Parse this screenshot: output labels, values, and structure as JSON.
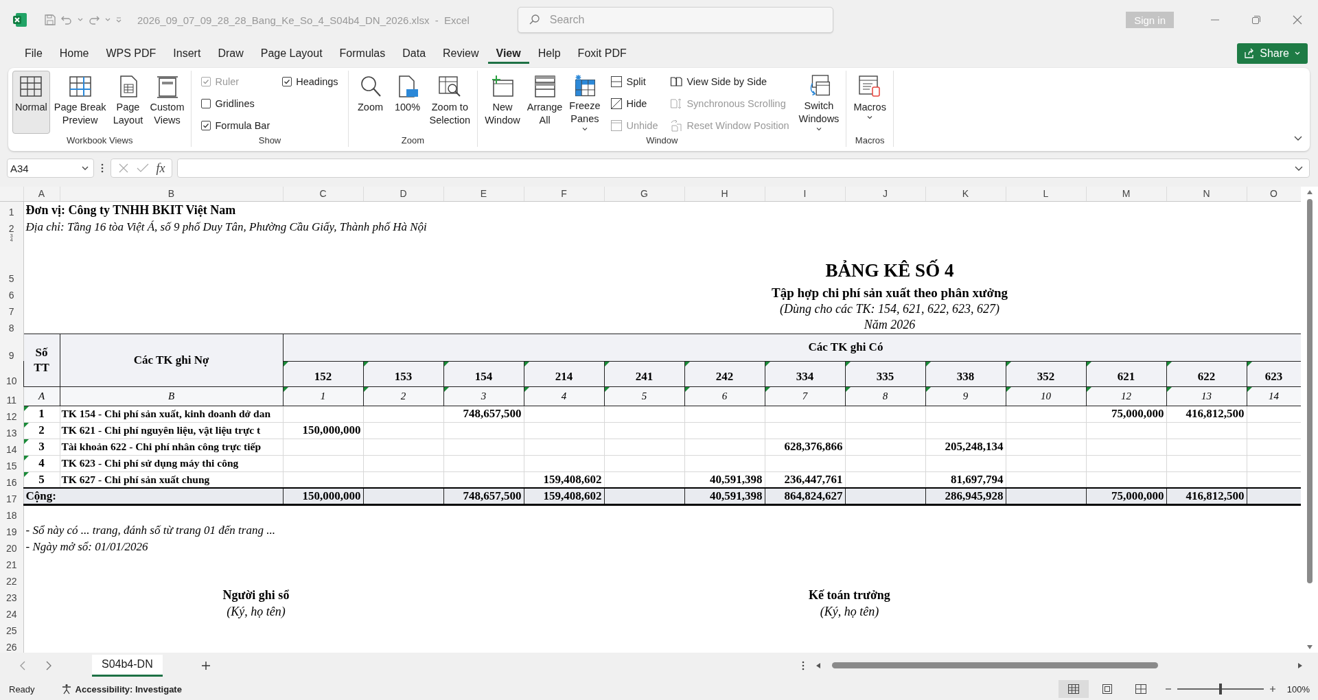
{
  "window": {
    "title": "2026_09_07_09_28_28_Bang_Ke_So_4_S04b4_DN_2026.xlsx  -  Excel"
  },
  "search": {
    "placeholder": "Search"
  },
  "account": {
    "sign_in": "Sign in"
  },
  "menu_tabs": [
    {
      "label": "File",
      "selected": false
    },
    {
      "label": "Home",
      "selected": false
    },
    {
      "label": "WPS PDF",
      "selected": false
    },
    {
      "label": "Insert",
      "selected": false
    },
    {
      "label": "Draw",
      "selected": false
    },
    {
      "label": "Page Layout",
      "selected": false
    },
    {
      "label": "Formulas",
      "selected": false
    },
    {
      "label": "Data",
      "selected": false
    },
    {
      "label": "Review",
      "selected": false
    },
    {
      "label": "View",
      "selected": true
    },
    {
      "label": "Help",
      "selected": false
    },
    {
      "label": "Foxit PDF",
      "selected": false
    }
  ],
  "share_button": "Share",
  "ribbon": {
    "groups": [
      {
        "label": "Workbook Views",
        "items": [
          {
            "kind": "large",
            "label": "Normal",
            "selected": true,
            "dropdown": false
          },
          {
            "kind": "large",
            "label": "Page Break\nPreview",
            "selected": false,
            "dropdown": false
          },
          {
            "kind": "large",
            "label": "Page\nLayout",
            "selected": false,
            "dropdown": false
          },
          {
            "kind": "large",
            "label": "Custom\nViews",
            "selected": false,
            "dropdown": false
          }
        ]
      },
      {
        "label": "Show",
        "items": [
          {
            "kind": "check",
            "label": "Ruler",
            "checked": true,
            "disabled": true
          },
          {
            "kind": "check",
            "label": "Gridlines",
            "checked": false,
            "disabled": false
          },
          {
            "kind": "check",
            "label": "Formula Bar",
            "checked": true,
            "disabled": false
          },
          {
            "kind": "check",
            "label": "Headings",
            "checked": true,
            "disabled": false
          }
        ]
      },
      {
        "label": "Zoom",
        "items": [
          {
            "kind": "large",
            "label": "Zoom",
            "selected": false,
            "dropdown": false
          },
          {
            "kind": "large",
            "label": "100%",
            "selected": false,
            "dropdown": false
          },
          {
            "kind": "large",
            "label": "Zoom to\nSelection",
            "selected": false,
            "dropdown": false
          }
        ]
      },
      {
        "label": "Window",
        "items": [
          {
            "kind": "large",
            "label": "New\nWindow",
            "selected": false,
            "dropdown": false
          },
          {
            "kind": "large",
            "label": "Arrange\nAll",
            "selected": false,
            "dropdown": false
          },
          {
            "kind": "large",
            "label": "Freeze\nPanes",
            "selected": false,
            "dropdown": true
          },
          {
            "kind": "small",
            "label": "Split",
            "disabled": false
          },
          {
            "kind": "small",
            "label": "Hide",
            "disabled": false
          },
          {
            "kind": "small",
            "label": "Unhide",
            "disabled": true
          },
          {
            "kind": "small",
            "label": "View Side by Side",
            "disabled": false
          },
          {
            "kind": "small",
            "label": "Synchronous Scrolling",
            "disabled": true
          },
          {
            "kind": "small",
            "label": "Reset Window Position",
            "disabled": true
          },
          {
            "kind": "large",
            "label": "Switch\nWindows",
            "selected": false,
            "dropdown": true
          }
        ]
      },
      {
        "label": "Macros",
        "items": [
          {
            "kind": "large",
            "label": "Macros",
            "selected": false,
            "dropdown": true
          }
        ]
      }
    ]
  },
  "formula_bar": {
    "name_box": "A34",
    "function_button": "fx"
  },
  "columns": [
    "A",
    "B",
    "C",
    "D",
    "E",
    "F",
    "G",
    "H",
    "I",
    "J",
    "K",
    "L",
    "M",
    "N",
    "O"
  ],
  "row_numbers": [
    "1",
    "2",
    "3",
    "4",
    "5",
    "6",
    "7",
    "8",
    "9",
    "10",
    "11",
    "12",
    "13",
    "14",
    "15",
    "16",
    "17",
    "18",
    "19",
    "20",
    "21",
    "22",
    "23",
    "24",
    "25",
    "26"
  ],
  "sheet": {
    "unit": "Đơn vị: Công ty TNHH BKIT Việt Nam",
    "address": "Địa chỉ: Tầng 16 tòa Việt Á, số 9 phố Duy Tân, Phường Cầu Giấy, Thành phố Hà Nội",
    "title": "BẢNG KÊ SỐ 4",
    "subtitle": "Tập hợp chi phí sản xuất theo phân xưởng",
    "scope": "(Dùng cho các TK: 154, 621, 622, 623, 627)",
    "year": "Năm 2026",
    "table": {
      "no_header": "Số TT",
      "debit_header": "Các TK ghi Nợ",
      "credit_header": "Các TK ghi Có",
      "index_a": "A",
      "index_b": "B",
      "credit_accounts": [
        {
          "account": "152",
          "index": "1",
          "flagged": true
        },
        {
          "account": "153",
          "index": "2",
          "flagged": true
        },
        {
          "account": "154",
          "index": "3",
          "flagged": true
        },
        {
          "account": "214",
          "index": "4",
          "flagged": true
        },
        {
          "account": "241",
          "index": "5",
          "flagged": true
        },
        {
          "account": "242",
          "index": "6",
          "flagged": true
        },
        {
          "account": "334",
          "index": "7",
          "flagged": true
        },
        {
          "account": "335",
          "index": "8",
          "flagged": true
        },
        {
          "account": "338",
          "index": "9",
          "flagged": true
        },
        {
          "account": "352",
          "index": "10",
          "flagged": true
        },
        {
          "account": "621",
          "index": "12",
          "flagged": true
        },
        {
          "account": "622",
          "index": "13",
          "flagged": true
        },
        {
          "account": "623",
          "index": "14",
          "flagged": true
        }
      ],
      "rows": [
        {
          "no": "1",
          "flagged": true,
          "account": "TK 154 - Chi phí sản xuất, kinh doanh dở dan",
          "amounts": [
            {
              "kind": "blank"
            },
            {
              "kind": "blank"
            },
            {
              "kind": "amount",
              "value": "748,657,500"
            },
            {
              "kind": "blank"
            },
            {
              "kind": "blank"
            },
            {
              "kind": "blank"
            },
            {
              "kind": "blank"
            },
            {
              "kind": "blank"
            },
            {
              "kind": "blank"
            },
            {
              "kind": "blank"
            },
            {
              "kind": "amount",
              "value": "75,000,000"
            },
            {
              "kind": "amount",
              "value": "416,812,500"
            },
            {
              "kind": "blank"
            }
          ]
        },
        {
          "no": "2",
          "flagged": true,
          "account": "TK 621 - Chi phí nguyên liệu, vật liệu trực t",
          "amounts": [
            {
              "kind": "amount",
              "value": "150,000,000"
            },
            {
              "kind": "blank"
            },
            {
              "kind": "blank"
            },
            {
              "kind": "blank"
            },
            {
              "kind": "blank"
            },
            {
              "kind": "blank"
            },
            {
              "kind": "blank"
            },
            {
              "kind": "blank"
            },
            {
              "kind": "blank"
            },
            {
              "kind": "blank"
            },
            {
              "kind": "blank"
            },
            {
              "kind": "blank"
            },
            {
              "kind": "blank"
            }
          ]
        },
        {
          "no": "3",
          "flagged": true,
          "account": "Tài khoản 622 - Chi phí nhân công trực tiếp",
          "amounts": [
            {
              "kind": "blank"
            },
            {
              "kind": "blank"
            },
            {
              "kind": "blank"
            },
            {
              "kind": "blank"
            },
            {
              "kind": "blank"
            },
            {
              "kind": "blank"
            },
            {
              "kind": "amount",
              "value": "628,376,866"
            },
            {
              "kind": "blank"
            },
            {
              "kind": "amount",
              "value": "205,248,134"
            },
            {
              "kind": "blank"
            },
            {
              "kind": "blank"
            },
            {
              "kind": "blank"
            },
            {
              "kind": "blank"
            }
          ]
        },
        {
          "no": "4",
          "flagged": true,
          "account": "TK 623 - Chi phí sử dụng máy thi công",
          "amounts": [
            {
              "kind": "blank"
            },
            {
              "kind": "blank"
            },
            {
              "kind": "blank"
            },
            {
              "kind": "blank"
            },
            {
              "kind": "blank"
            },
            {
              "kind": "blank"
            },
            {
              "kind": "blank"
            },
            {
              "kind": "blank"
            },
            {
              "kind": "blank"
            },
            {
              "kind": "blank"
            },
            {
              "kind": "blank"
            },
            {
              "kind": "blank"
            },
            {
              "kind": "blank"
            }
          ]
        },
        {
          "no": "5",
          "flagged": true,
          "account": "TK 627 - Chi phí sản xuất chung",
          "amounts": [
            {
              "kind": "blank"
            },
            {
              "kind": "blank"
            },
            {
              "kind": "blank"
            },
            {
              "kind": "amount",
              "value": "159,408,602"
            },
            {
              "kind": "blank"
            },
            {
              "kind": "amount",
              "value": "40,591,398"
            },
            {
              "kind": "amount",
              "value": "236,447,761"
            },
            {
              "kind": "blank"
            },
            {
              "kind": "amount",
              "value": "81,697,794"
            },
            {
              "kind": "blank"
            },
            {
              "kind": "blank"
            },
            {
              "kind": "blank"
            },
            {
              "kind": "blank"
            }
          ]
        }
      ],
      "total": {
        "label": "Cộng:",
        "amounts": [
          {
            "kind": "amount",
            "value": "150,000,000"
          },
          {
            "kind": "blank"
          },
          {
            "kind": "amount",
            "value": "748,657,500"
          },
          {
            "kind": "amount",
            "value": "159,408,602"
          },
          {
            "kind": "blank"
          },
          {
            "kind": "amount",
            "value": "40,591,398"
          },
          {
            "kind": "amount",
            "value": "864,824,627"
          },
          {
            "kind": "blank"
          },
          {
            "kind": "amount",
            "value": "286,945,928"
          },
          {
            "kind": "blank"
          },
          {
            "kind": "amount",
            "value": "75,000,000"
          },
          {
            "kind": "amount",
            "value": "416,812,500"
          },
          {
            "kind": "blank"
          }
        ]
      }
    },
    "notes": [
      "- Sổ này có ... trang, đánh số từ trang 01 đến trang ...",
      "- Ngày mở sổ: 01/01/2026"
    ],
    "signatures": [
      {
        "title": "Người ghi sổ",
        "hint": "(Ký, họ tên)"
      },
      {
        "title": "Kế toán trưởng",
        "hint": "(Ký, họ tên)"
      }
    ]
  },
  "sheet_tabs": [
    {
      "label": "S04b4-DN",
      "selected": true
    }
  ],
  "status_bar": {
    "mode": "Ready",
    "accessibility": "Accessibility: Investigate",
    "views": [
      {
        "selected": true
      },
      {
        "selected": false
      },
      {
        "selected": false
      }
    ],
    "zoom": {
      "level": 0.5,
      "reading": "100%"
    }
  }
}
